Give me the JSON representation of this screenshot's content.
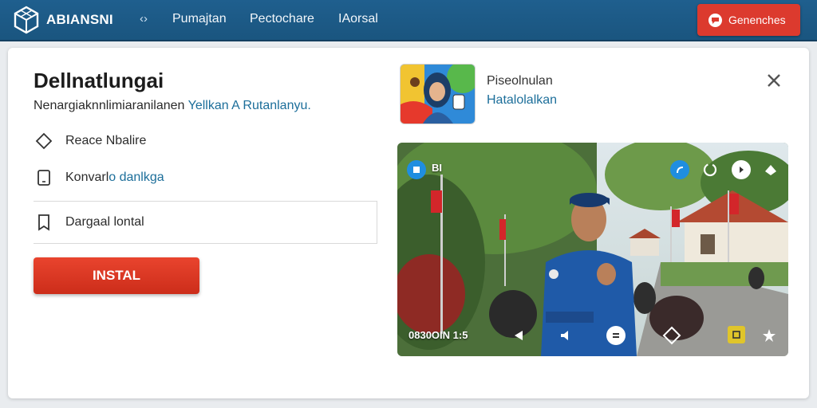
{
  "header": {
    "brand": "ABIANSNI",
    "nav_arrows": "‹›",
    "nav": [
      "Pumajtan",
      "Pectochare",
      "IAorsal"
    ],
    "action_button": "Genenches",
    "colors": {
      "bar": "#1f5f8e",
      "action": "#dc3a2e"
    }
  },
  "main": {
    "title": "Dellnatlungai",
    "subtitle_plain": "Nenargiaknnlimiaranilanen ",
    "subtitle_link": "Yellkan A Rutanlanyu.",
    "options": [
      {
        "label": "Reace Nbalire",
        "icon": "diamond-icon"
      },
      {
        "label_plain": "Konvarl",
        "label_link": "o danlkga",
        "icon": "tablet-icon"
      },
      {
        "label": "Dargaal lontal",
        "icon": "bookmark-icon"
      }
    ],
    "install_label": "INSTAL",
    "install_color": "#e03b26"
  },
  "app": {
    "name": "Piseolnulan",
    "subtitle": "Hatalolalkan",
    "close_icon": "close-icon"
  },
  "video": {
    "badge_text": "BI",
    "time": "0830OIN 1:5",
    "top_icons": [
      "share-icon",
      "refresh-icon",
      "mute-icon",
      "settings-icon"
    ],
    "bottom_icons": [
      "prev-icon",
      "volume-icon",
      "caption-icon",
      "fullscreen-icon",
      "favorite-icon"
    ]
  }
}
